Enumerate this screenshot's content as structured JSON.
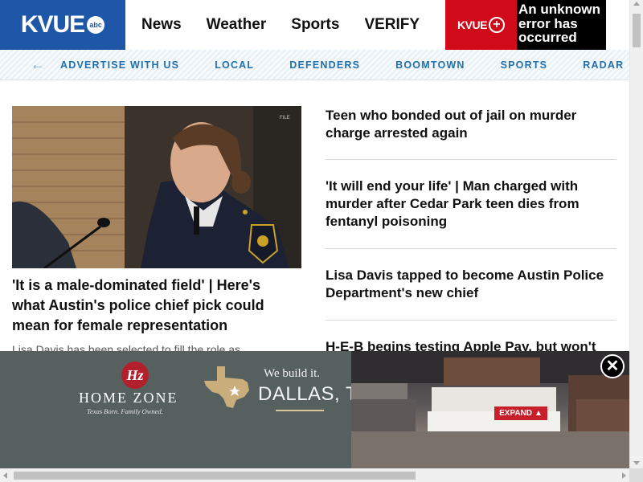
{
  "header": {
    "logo": "KVUE",
    "logo_badge": "abc",
    "nav": [
      "News",
      "Weather",
      "Sports",
      "VERIFY"
    ],
    "kvueplus_label": "KVUE",
    "kvueplus_plus": "+",
    "error_text": "An unknown error has occurred"
  },
  "subnav": {
    "back_icon": "arrow-left-icon",
    "items": [
      "ADVERTISE WITH US",
      "LOCAL",
      "DEFENDERS",
      "BOOMTOWN",
      "SPORTS",
      "RADAR"
    ]
  },
  "lead": {
    "badge": "FILE",
    "headline": "'It is a male-dominated field' | Here's what Austin's police chief pick could mean for female representation",
    "summary": "Lisa Davis has been selected to fill the role as"
  },
  "stories": [
    "Teen who bonded out of jail on murder charge arrested again",
    "'It will end your life' | Man charged with murder after Cedar Park teen dies from fentanyl poisoning",
    "Lisa Davis tapped to become Austin Police Department's new chief",
    "H-E-B begins testing Apple Pay, but won't"
  ],
  "ad": {
    "logo_mark": "Hz",
    "brand": "HOME ZONE",
    "tagline": "Texas Born. Family Owned.",
    "built_text": "We build it.",
    "city_text": "DALLAS, TX",
    "expand_label": "EXPAND",
    "close_icon": "close-icon"
  },
  "colors": {
    "brand_blue": "#1f57a8",
    "kvueplus_red": "#d10a1a",
    "subnav_link": "#1f70ad",
    "ad_bg": "#56605f"
  }
}
